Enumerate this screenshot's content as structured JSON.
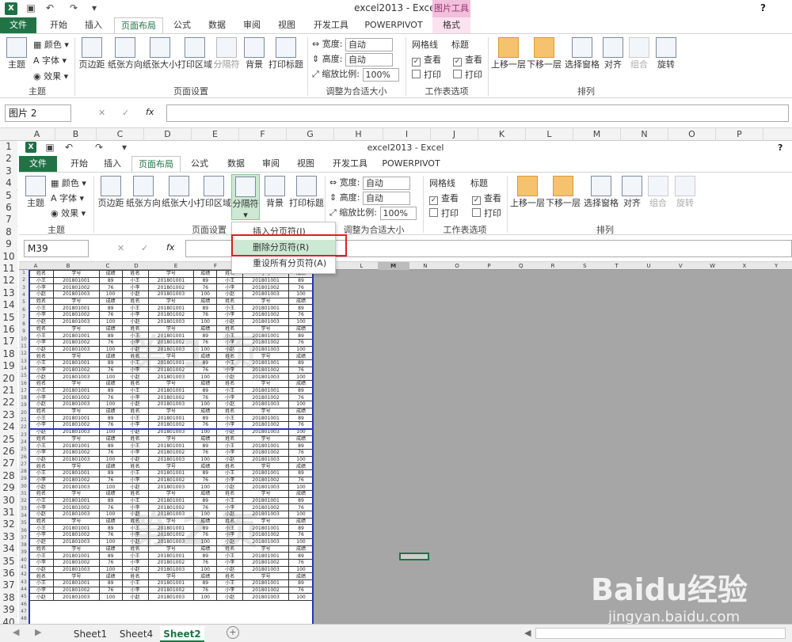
{
  "window": {
    "app_icon": "X",
    "title": "excel2013 - Excel",
    "help": "?",
    "controls": [
      "—",
      "❐",
      "✕"
    ]
  },
  "outer": {
    "tabs": [
      "文件",
      "开始",
      "插入",
      "页面布局",
      "公式",
      "数据",
      "审阅",
      "视图",
      "开发工具",
      "POWERPIVOT"
    ],
    "context_group": "图片工具",
    "context_tab": "格式",
    "name_box": "图片 2",
    "ribbon": {
      "theme": {
        "big": "主题",
        "colors": "颜色",
        "fonts": "字体",
        "effects": "效果",
        "group": "主题"
      },
      "page_setup": {
        "buttons": [
          "页边距",
          "纸张方向",
          "纸张大小",
          "打印区域",
          "分隔符",
          "背景",
          "打印标题"
        ],
        "group": "页面设置"
      },
      "scale": {
        "width_label": "宽度:",
        "width_val": "自动",
        "height_label": "高度:",
        "height_val": "自动",
        "scale_label": "缩放比例:",
        "scale_val": "100%",
        "group": "调整为合适大小"
      },
      "sheet_opts": {
        "gridlines": "网格线",
        "headings": "标题",
        "view": "查看",
        "print": "打印",
        "group": "工作表选项"
      },
      "arrange": {
        "buttons": [
          "上移一层",
          "下移一层",
          "选择窗格",
          "对齐",
          "组合",
          "旋转"
        ],
        "group": "排列"
      }
    }
  },
  "outer_cols": [
    "A",
    "B",
    "C",
    "D",
    "E",
    "F",
    "G",
    "H",
    "I",
    "J",
    "K",
    "L",
    "M",
    "N",
    "O",
    "P"
  ],
  "outer_rows": [
    "1",
    "2",
    "3",
    "4",
    "5",
    "6",
    "7",
    "8",
    "9",
    "10",
    "11",
    "12",
    "13",
    "14",
    "15",
    "16",
    "17",
    "18",
    "19",
    "20",
    "21",
    "22",
    "23",
    "24",
    "25",
    "26",
    "27",
    "28",
    "29",
    "30",
    "31",
    "32",
    "33",
    "34",
    "35",
    "36",
    "37",
    "38",
    "39",
    "40"
  ],
  "inner": {
    "tabs": [
      "文件",
      "开始",
      "插入",
      "页面布局",
      "公式",
      "数据",
      "审阅",
      "视图",
      "开发工具",
      "POWERPIVOT"
    ],
    "name_box": "M39",
    "fx": "fx",
    "menu": [
      "插入分页符(I)",
      "删除分页符(R)",
      "重设所有分页符(A)"
    ],
    "gray_cols": [
      "K",
      "L",
      "M",
      "N",
      "O",
      "P",
      "Q",
      "R",
      "S",
      "T",
      "U",
      "V",
      "W",
      "X",
      "Y"
    ],
    "headers": [
      "A",
      "B",
      "C",
      "D",
      "E",
      "F",
      "G",
      "H",
      "I",
      "J"
    ]
  },
  "table": {
    "header": [
      "姓名",
      "学号",
      "成绩",
      "姓名",
      "学号",
      "成绩",
      "姓名",
      "学号",
      "成绩"
    ],
    "r1": [
      "小王",
      "201801001",
      "89",
      "小王",
      "201801001",
      "89",
      "小王",
      "201801001",
      "89"
    ],
    "r2": [
      "小李",
      "201801002",
      "76",
      "小李",
      "201801002",
      "76",
      "小李",
      "201801002",
      "76"
    ],
    "r3": [
      "小赵",
      "201801003",
      "100",
      "小赵",
      "201801003",
      "100",
      "小赵",
      "201801003",
      "100"
    ]
  },
  "watermarks": [
    "第 1 页",
    "第 2 页"
  ],
  "sheets": [
    "Sheet1",
    "Sheet4",
    "Sheet2"
  ],
  "active_sheet": "Sheet2",
  "baidu": {
    "logo": "Baidu经验",
    "url": "jingyan.baidu.com"
  }
}
